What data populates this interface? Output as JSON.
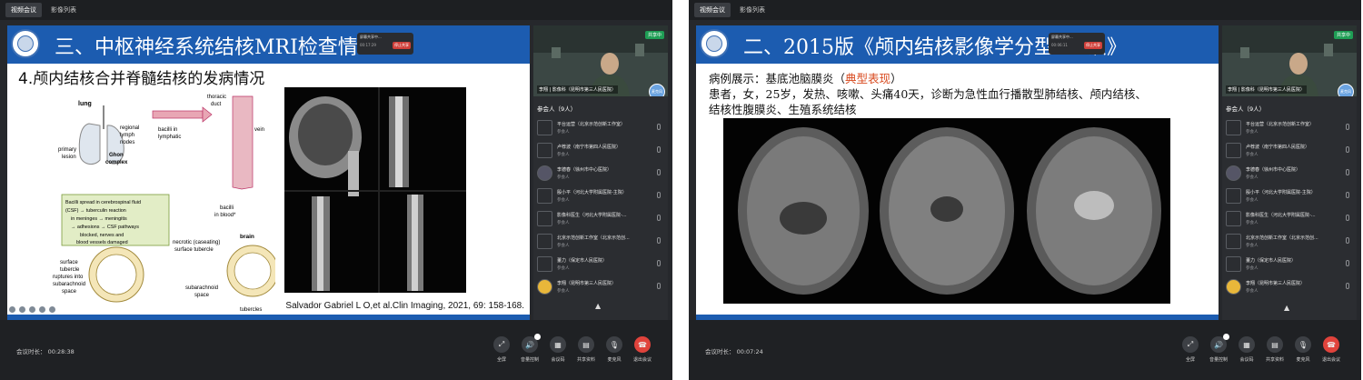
{
  "left": {
    "tabs": [
      "视频会议",
      "影像列表"
    ],
    "slide": {
      "title": "三、中枢神经系统结核MRI检查情",
      "subtitle": "4.颅内结核合并脊髓结核的发病情况",
      "citation": "Salvador Gabriel L O,et al.Clin Imaging, 2021, 69: 158-168.",
      "diagram": {
        "lung": "lung",
        "primary_lesion": [
          "primary",
          "lesion"
        ],
        "regional": [
          "regional",
          "lymph",
          "nodes"
        ],
        "ghon": [
          "Ghon",
          "complex"
        ],
        "bacilli_lymphatic": [
          "bacilli in",
          "lymphatic"
        ],
        "thoracic_duct": [
          "thoracic",
          "duct"
        ],
        "vein": "vein",
        "bacilli_blood": [
          "bacilli",
          "in blood*"
        ],
        "box_lines": [
          "Bacilli spread in cerebrospinal fluid",
          "(CSF) → tuberculin reaction",
          "in meninges → meningitis",
          "→ adhesions → CSF pathways",
          "blocked, nerves and",
          "blood vessels damaged"
        ],
        "brain": "brain",
        "necrotic": [
          "necrotic (caseating)",
          "surface tubercle"
        ],
        "surface": [
          "surface",
          "tubercle",
          "ruptures into",
          "subarachnoid",
          "space"
        ],
        "subarachnoid": [
          "subarachnoid",
          "space"
        ],
        "tubercles": "tubercles"
      }
    },
    "popup": {
      "title": "屏幕共享中...",
      "time": "00:17:29",
      "button": "停止共享"
    },
    "video": {
      "badge": "共享中",
      "name": "李翔 | 影像科（昆明市第三人民医院）",
      "bubble": "麦克风"
    },
    "participants_header": "参会人（9人）",
    "participants": [
      {
        "name": "平台运营（北京示范创新工作室）",
        "state": "参会人",
        "avatar": "blank"
      },
      {
        "name": "卢荐波（南宁市第四人民医院）",
        "state": "参会人",
        "avatar": "blank"
      },
      {
        "name": "李德春（徐州市中心医院）",
        "state": "参会人",
        "avatar": "photo"
      },
      {
        "name": "殷小平（河北大学附属医院-主院）",
        "state": "参会人",
        "avatar": "blank"
      },
      {
        "name": "影像科医生（河北大学附属医院-...",
        "state": "参会人",
        "avatar": "blank"
      },
      {
        "name": "北京示范创新工作室（北京示范创...",
        "state": "参会人",
        "avatar": "blank"
      },
      {
        "name": "董力（保定市人民医院）",
        "state": "参会人",
        "avatar": "blank"
      },
      {
        "name": "李翔（昆明市第三人民医院）",
        "state": "参会人",
        "avatar": "gold"
      }
    ],
    "meeting_time": "会议时长： 00:28:38",
    "controls": [
      {
        "icon": "fullscreen-icon",
        "label": "全屏",
        "glyph": "⤢"
      },
      {
        "icon": "volume-icon",
        "label": "音量控制",
        "glyph": "🔊"
      },
      {
        "icon": "qrcode-icon",
        "label": "会议码",
        "glyph": "▦"
      },
      {
        "icon": "document-icon",
        "label": "共享资料",
        "glyph": "▤"
      },
      {
        "icon": "microphone-icon",
        "label": "麦克风",
        "glyph": "🎙"
      },
      {
        "icon": "hangup-icon",
        "label": "退出会议",
        "glyph": "☎"
      }
    ]
  },
  "right": {
    "tabs": [
      "视频会议",
      "影像列表"
    ],
    "slide": {
      "title": "二、2015版《颅内结核影像学分型",
      "title_tail": "识》",
      "line1_prefix": "病例展示：基底池脑膜炎（",
      "line1_highlight": "典型表现",
      "line1_suffix": "）",
      "line2": "患者，女，25岁，发热、咳嗽、头痛40天，诊断为急性血行播散型肺结核、颅内结核、",
      "line3": "结核性腹膜炎、生殖系统结核"
    },
    "popup": {
      "title": "屏幕共享中...",
      "time": "00:06:11",
      "button": "停止共享"
    },
    "video": {
      "badge": "共享中",
      "name": "李翔 | 影像科（昆明市第三人民医院）",
      "bubble": "麦克风"
    },
    "participants_header": "参会人（9人）",
    "participants": [
      {
        "name": "平台运营（北京示范创新工作室）",
        "state": "参会人",
        "avatar": "blank"
      },
      {
        "name": "卢荐波（南宁市第四人民医院）",
        "state": "参会人",
        "avatar": "blank"
      },
      {
        "name": "李德春（徐州市中心医院）",
        "state": "参会人",
        "avatar": "photo"
      },
      {
        "name": "殷小平（河北大学附属医院-主院）",
        "state": "参会人",
        "avatar": "blank"
      },
      {
        "name": "影像科医生（河北大学附属医院-...",
        "state": "参会人",
        "avatar": "blank"
      },
      {
        "name": "北京示范创新工作室（北京示范创...",
        "state": "参会人",
        "avatar": "blank"
      },
      {
        "name": "董力（保定市人民医院）",
        "state": "参会人",
        "avatar": "blank"
      },
      {
        "name": "李翔（昆明市第三人民医院）",
        "state": "参会人",
        "avatar": "gold"
      }
    ],
    "meeting_time": "会议时长： 00:07:24",
    "controls": [
      {
        "icon": "fullscreen-icon",
        "label": "全屏",
        "glyph": "⤢"
      },
      {
        "icon": "volume-icon",
        "label": "音量控制",
        "glyph": "🔊"
      },
      {
        "icon": "qrcode-icon",
        "label": "会议码",
        "glyph": "▦"
      },
      {
        "icon": "document-icon",
        "label": "共享资料",
        "glyph": "▤"
      },
      {
        "icon": "microphone-icon",
        "label": "麦克风",
        "glyph": "🎙"
      },
      {
        "icon": "hangup-icon",
        "label": "退出会议",
        "glyph": "☎"
      }
    ]
  }
}
